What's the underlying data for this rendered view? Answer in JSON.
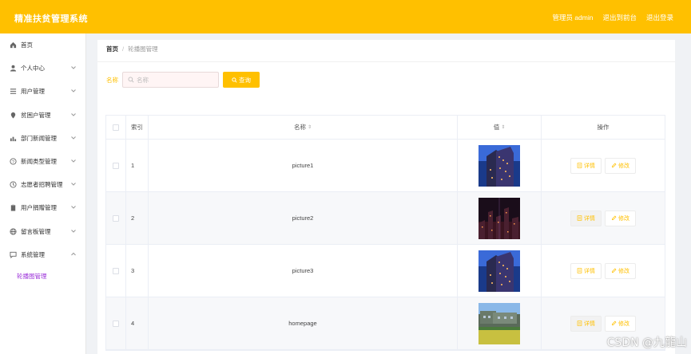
{
  "header": {
    "title": "精准扶贫管理系统",
    "admin_label": "管理员 admin",
    "back_label": "退出到前台",
    "logout_label": "退出登录",
    "accent": "#ffc000"
  },
  "sidebar": {
    "items": [
      {
        "label": "首页",
        "icon": "home-icon"
      },
      {
        "label": "个人中心",
        "icon": "user-icon"
      },
      {
        "label": "用户管理",
        "icon": "list-icon"
      },
      {
        "label": "贫困户管理",
        "icon": "location-icon"
      },
      {
        "label": "部门新闻管理",
        "icon": "chart-icon"
      },
      {
        "label": "新闻类型管理",
        "icon": "help-icon"
      },
      {
        "label": "志愿者招聘管理",
        "icon": "clock-icon"
      },
      {
        "label": "用户捐赠管理",
        "icon": "clipboard-icon"
      },
      {
        "label": "留言板管理",
        "icon": "globe-icon"
      },
      {
        "label": "系统管理",
        "icon": "message-icon"
      }
    ],
    "sub_item": "轮播图管理",
    "sub_color": "#9b30d9"
  },
  "breadcrumb": {
    "home": "首页",
    "sep": "/",
    "current": "轮播图管理"
  },
  "search": {
    "label": "名称",
    "placeholder": "名称",
    "button": "查询"
  },
  "table": {
    "headers": {
      "index": "索引",
      "name": "名称",
      "value": "值",
      "ops": "操作"
    },
    "rows": [
      {
        "index": "1",
        "name": "picture1",
        "thumb": "building-night"
      },
      {
        "index": "2",
        "name": "picture2",
        "thumb": "city-lights"
      },
      {
        "index": "3",
        "name": "picture3",
        "thumb": "building-night"
      },
      {
        "index": "4",
        "name": "homepage",
        "thumb": "field-building"
      }
    ],
    "detail_label": "详情",
    "edit_label": "修改"
  },
  "watermark": "CSDN @九龍山"
}
